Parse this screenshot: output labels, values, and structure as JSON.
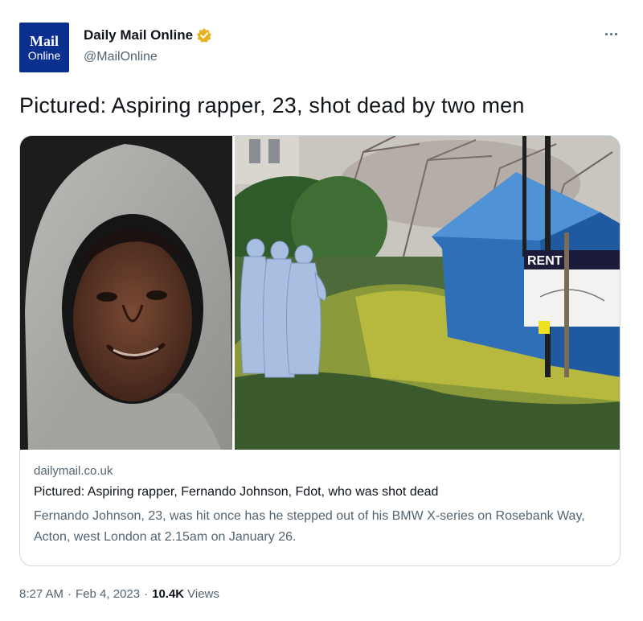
{
  "author": {
    "avatar_line1": "Mail",
    "avatar_line2": "Online",
    "display_name": "Daily Mail Online",
    "handle": "@MailOnline",
    "verified_icon": "verified-badge-icon",
    "verified_color": "#e8b122"
  },
  "more_icon": "more-options-icon",
  "tweet": {
    "text": "Pictured: Aspiring rapper, 23, shot dead by two men"
  },
  "card": {
    "domain": "dailymail.co.uk",
    "title": "Pictured: Aspiring rapper, Fernando Johnson, Fdot, who was shot dead",
    "description": "Fernando Johnson, 23, was hit once has he stepped out of his BMW X-series on Rosebank Way, Acton, west London at 2.15am on January 26.",
    "rent_sign": "RENT"
  },
  "meta": {
    "time": "8:27 AM",
    "separator": "·",
    "date": "Feb 4, 2023",
    "views_count": "10.4K",
    "views_label": "Views"
  },
  "colors": {
    "brand_blue": "#0a2f8f",
    "secondary_text": "#536471",
    "primary_text": "#0f1419",
    "border": "#cfd9de"
  }
}
